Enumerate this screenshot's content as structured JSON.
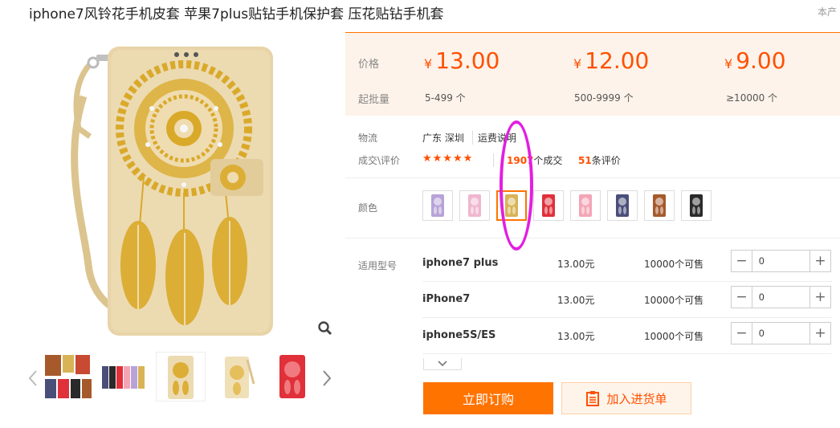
{
  "product": {
    "title": "iphone7风铃花手机皮套 苹果7plus贴钻手机保护套 压花贴钻手机套",
    "corner_note": "本产"
  },
  "pricing": {
    "price_label": "价格",
    "batch_label": "起批量",
    "currency": "¥",
    "tiers": [
      {
        "price": "13.00",
        "batch": "5-499 个"
      },
      {
        "price": "12.00",
        "batch": "500-9999 个"
      },
      {
        "price": "9.00",
        "batch": "≥10000 个"
      }
    ]
  },
  "logistics": {
    "label": "物流",
    "location": "广东 深圳",
    "freight_link": "运费说明"
  },
  "deals": {
    "label": "成交\\评价",
    "stars": "★★★★★",
    "rating": 5,
    "count": "1907",
    "count_suffix": "个成交",
    "reviews": "51",
    "reviews_suffix": "条评价"
  },
  "colors": {
    "label": "颜色",
    "swatches": [
      {
        "name": "purple",
        "color": "#b7a3d8"
      },
      {
        "name": "pink",
        "color": "#f0b6cf"
      },
      {
        "name": "gold",
        "color": "#d8b456",
        "selected": true
      },
      {
        "name": "red",
        "color": "#e0303a"
      },
      {
        "name": "light-pink",
        "color": "#f4a5b5"
      },
      {
        "name": "navy",
        "color": "#4a4f7a"
      },
      {
        "name": "brown",
        "color": "#a65a2c"
      },
      {
        "name": "black",
        "color": "#2a2a2a"
      }
    ]
  },
  "models": {
    "label": "适用型号",
    "rows": [
      {
        "name": "iphone7 plus",
        "price": "13.00元",
        "stock": "10000个可售",
        "qty": "0"
      },
      {
        "name": "iPhone7",
        "price": "13.00元",
        "stock": "10000个可售",
        "qty": "0"
      },
      {
        "name": "iphone5S/ES",
        "price": "13.00元",
        "stock": "10000个可售",
        "qty": "0"
      }
    ]
  },
  "actions": {
    "order": "立即订购",
    "cart": "加入进货单"
  },
  "thumbnails": [
    {
      "name": "multi-color-pack"
    },
    {
      "name": "color-lineup"
    },
    {
      "name": "gold-front"
    },
    {
      "name": "gold-back"
    },
    {
      "name": "red-front"
    }
  ],
  "icons": {
    "zoom": "zoom-icon",
    "prev": "chevron-left-icon",
    "next": "chevron-right-icon",
    "expand": "chevron-down-icon",
    "cart": "clipboard-icon"
  },
  "theme": {
    "accent": "#ff7300",
    "price_color": "#ff5000",
    "annotation": "#e21ee0"
  }
}
